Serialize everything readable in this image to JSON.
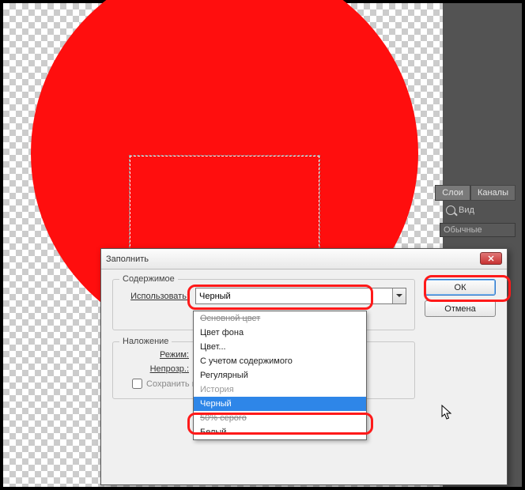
{
  "panels": {
    "tab_layers": "Слои",
    "tab_channels": "Каналы",
    "search_placeholder": "Вид",
    "blend_label": "Обычные"
  },
  "dialog": {
    "title": "Заполнить",
    "group_contents": "Содержимое",
    "label_use": "Использовать:",
    "use_value": "Черный",
    "group_blending": "Наложение",
    "label_mode": "Режим:",
    "label_opacity": "Непрозр.:",
    "checkbox_preserve": "Сохранить п",
    "btn_ok": "ОК",
    "btn_cancel": "Отмена"
  },
  "dropdown": {
    "items": [
      {
        "label": "Основной цвет",
        "state": "strike"
      },
      {
        "label": "Цвет фона",
        "state": ""
      },
      {
        "label": "Цвет...",
        "state": ""
      },
      {
        "label": "С учетом содержимого",
        "state": ""
      },
      {
        "label": "Регулярный",
        "state": ""
      },
      {
        "label": "История",
        "state": "disabled"
      },
      {
        "label": "Черный",
        "state": "sel"
      },
      {
        "label": "50% серого",
        "state": "strike"
      },
      {
        "label": "Белый",
        "state": ""
      }
    ]
  }
}
